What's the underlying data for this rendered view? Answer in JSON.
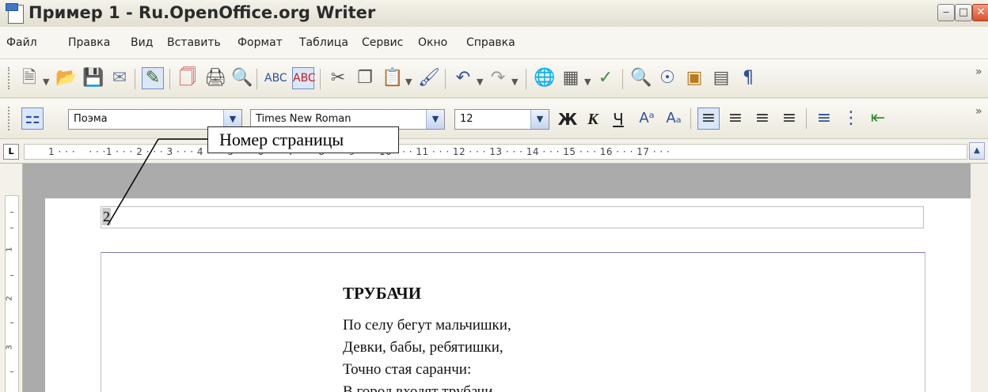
{
  "window": {
    "title": "Пример 1 - Ru.OpenOffice.org Writer",
    "min_symbol": "‒",
    "max_symbol": "□",
    "close_symbol": "✕"
  },
  "menu": [
    "Файл",
    "Правка",
    "Вид",
    "Вставить",
    "Формат",
    "Таблица",
    "Сервис",
    "Окно",
    "Справка"
  ],
  "formatting": {
    "style_value": "Поэма",
    "font_value": "Times New Roman",
    "size_value": "12",
    "bold_label": "Ж",
    "italic_label": "К",
    "underline_label": "Ч",
    "dropdown_arrow": "▼"
  },
  "ruler": {
    "corner_label": "L",
    "marks_text": "1 · · ·    · · ·1 · · · 2 · · · 3 · · · 4 · · · 5 · · · 6 · · · 7 · · · 8 · · · 9 · · · 10 · · · 11 · · · 12 · · · 13 · · · 14 · · · 15 · · · 16 · · · 17 · · ·",
    "scroll_up": "▲"
  },
  "vertical_ruler": {
    "marks": [
      "1",
      "2",
      "3"
    ]
  },
  "document": {
    "page_number": "2",
    "poem_title": "ТРУБАЧИ",
    "poem_lines": [
      "По селу бегут мальчишки,",
      "Девки, бабы, ребятишки,",
      "Точно стая саранчи:",
      "В город входят трубачи"
    ]
  },
  "callout": {
    "text": "Номер страницы"
  }
}
